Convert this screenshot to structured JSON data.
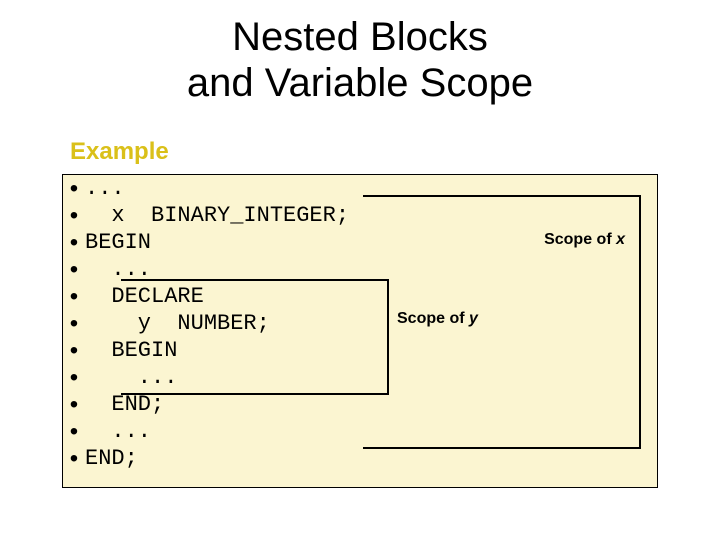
{
  "title_line1": "Nested Blocks",
  "title_line2": "and Variable Scope",
  "subhead": "Example",
  "scope_x_label_prefix": "Scope of ",
  "scope_x_var": "x",
  "scope_y_label_prefix": "Scope of ",
  "scope_y_var": "y",
  "code": {
    "l0": "...",
    "l1": "  x  BINARY_INTEGER;",
    "l2": "BEGIN",
    "l3": "  ...",
    "l4": "  DECLARE",
    "l5": "    y  NUMBER;",
    "l6": "  BEGIN",
    "l7": "    ...",
    "l8": "  END;",
    "l9": "  ...",
    "l10": "END;"
  }
}
